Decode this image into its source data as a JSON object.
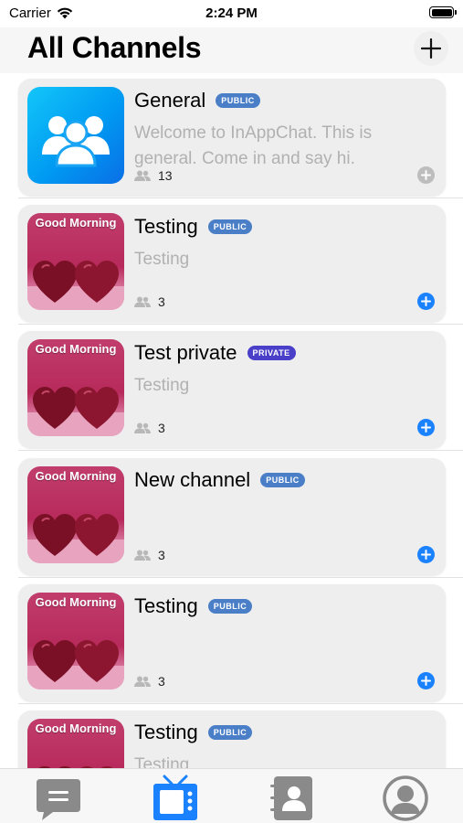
{
  "status_bar": {
    "carrier": "Carrier",
    "time": "2:24 PM"
  },
  "header": {
    "title": "All Channels",
    "add_icon": "plus-icon"
  },
  "channels": [
    {
      "name": "General",
      "badge": "PUBLIC",
      "description": "Welcome to InAppChat. This is general. Come in and say hi.",
      "members": "13",
      "thumbnail": "users-group-icon",
      "action_color": "#bdbdbd"
    },
    {
      "name": "Testing",
      "badge": "PUBLIC",
      "description": "Testing",
      "members": "3",
      "thumbnail_text": "Good Morning",
      "action_color": "#1a82ff"
    },
    {
      "name": "Test private",
      "badge": "PRIVATE",
      "description": "Testing",
      "members": "3",
      "thumbnail_text": "Good Morning",
      "action_color": "#1a82ff"
    },
    {
      "name": "New channel",
      "badge": "PUBLIC",
      "description": "",
      "members": "3",
      "thumbnail_text": "Good Morning",
      "action_color": "#1a82ff"
    },
    {
      "name": "Testing",
      "badge": "PUBLIC",
      "description": "",
      "members": "3",
      "thumbnail_text": "Good Morning",
      "action_color": "#1a82ff"
    },
    {
      "name": "Testing",
      "badge": "PUBLIC",
      "description": "Testing",
      "members": "",
      "thumbnail_text": "Good Morning",
      "action_color": "#1a82ff"
    }
  ],
  "tabs": [
    {
      "id": "chats",
      "icon": "chat-icon",
      "active": false
    },
    {
      "id": "channels",
      "icon": "tv-icon",
      "active": true
    },
    {
      "id": "contacts",
      "icon": "contacts-book-icon",
      "active": false
    },
    {
      "id": "profile",
      "icon": "profile-icon",
      "active": false
    }
  ],
  "colors": {
    "accent": "#1a82ff",
    "public_badge": "#4a7fc8",
    "private_badge": "#4a3fc9",
    "active_tab": "#1a82ff",
    "inactive_tab": "#8a8a8a"
  }
}
